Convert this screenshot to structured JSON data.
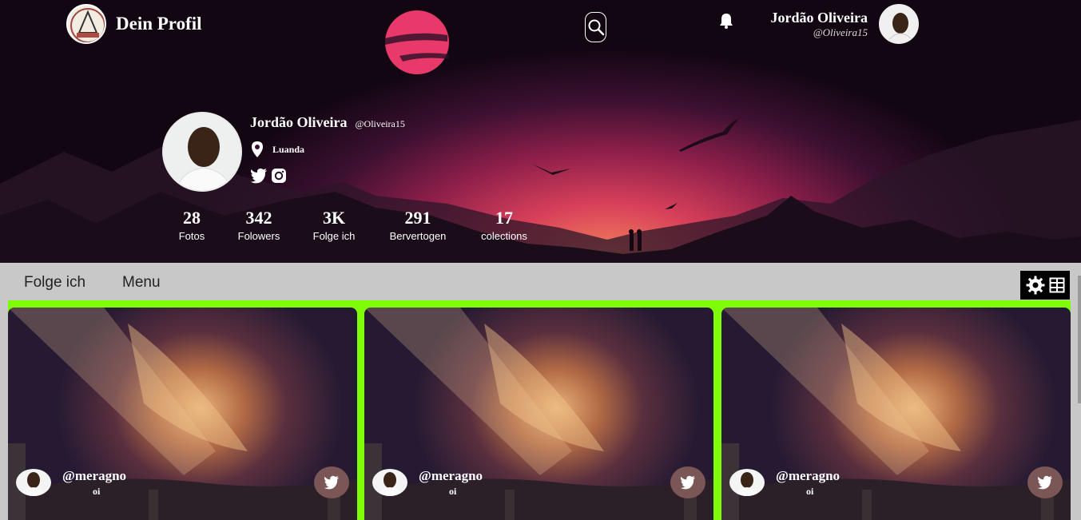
{
  "header": {
    "title": "Dein Profil",
    "user_name": "Jordão Oliveira",
    "user_handle": "@Oliveira15"
  },
  "profile": {
    "name": "Jordão Oliveira",
    "handle": "@Oliveira15",
    "location": "Luanda",
    "stats": [
      {
        "value": "28",
        "label": "Fotos"
      },
      {
        "value": "342",
        "label": "Folowers"
      },
      {
        "value": "3K",
        "label": "Folge ich"
      },
      {
        "value": "291",
        "label": "Bervertogen"
      },
      {
        "value": "17",
        "label": "colections"
      }
    ]
  },
  "toolbar": {
    "link1": "Folge ich",
    "link2": "Menu"
  },
  "cards": [
    {
      "user": "@meragno",
      "sub": "oi"
    },
    {
      "user": "@meragno",
      "sub": "oi"
    },
    {
      "user": "@meragno",
      "sub": "oi"
    }
  ],
  "colors": {
    "grid_border": "#7ffc08",
    "toolbar_bg": "#c8c8c8",
    "twitter_btn": "#7a5656"
  },
  "icons": [
    "search-icon",
    "bell-icon",
    "location-pin-icon",
    "twitter-icon",
    "instagram-icon",
    "gear-icon",
    "grid-icon"
  ]
}
